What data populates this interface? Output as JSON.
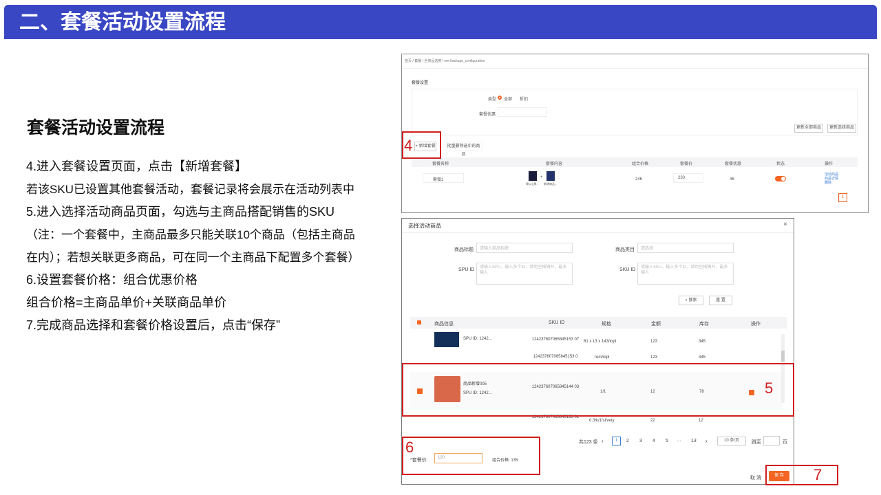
{
  "slide": {
    "header_title": "二、套餐活动设置流程",
    "subtitle": "套餐活动设置流程",
    "lines": [
      "4.进入套餐设置页面，点击【新增套餐】",
      "若该SKU已设置其他套餐活动，套餐记录将会展示在活动列表中",
      "5.进入选择活动商品页面，勾选与主商品搭配销售的SKU",
      "（注：一个套餐中，主商品最多只能关联10个商品（包括主商品",
      "在内）；若想关联更多商品，可在同一个主商品下配置多个套餐）",
      "6.设置套餐价格：组合优惠价格",
      "组合价格=主商品单价+关联商品单价",
      "7.完成商品选择和套餐价格设置后，点击“保存”"
    ]
  },
  "top_screen": {
    "breadcrumb": "首页 / 套餐 / 全商品选用 / em-hackage_configuration",
    "section_title": "套餐设置",
    "type_label": "类型",
    "type_opt1": "全部",
    "type_opt2": "折扣",
    "discount_label": "套餐优惠",
    "btn_a": "更新全部商品",
    "btn_b": "更新选择商品",
    "add_btn": "+ 新增套餐",
    "batch_btn": "批量删除选中的商品",
    "cols": [
      "套餐名称",
      "套餐内容",
      "组合价格",
      "套餐价",
      "套餐优惠",
      "状态",
      "操作"
    ],
    "row": {
      "name": "套餐1",
      "p1": "果to山果...",
      "plus": "+",
      "p2": "新增商品...",
      "combo": "246",
      "price": "230",
      "disc": "46",
      "ops": [
        "活动商品",
        "商品详情",
        "删除"
      ]
    },
    "page_num": "1",
    "marker": "4"
  },
  "modal": {
    "title": "选择活动商品",
    "close": "×",
    "f_title_label": "商品标题",
    "f_title_ph": "请输入商品标题",
    "f_cat_label": "商品类目",
    "f_cat_ph": "请选择",
    "f_spu_label": "SPU ID",
    "f_spu_ph": "请输入SPU，输入多个ID，请用空格隔开，最多输入",
    "f_sku_label": "SKU ID",
    "f_sku_ph": "请输入SKU，输入多个ID，请用空格隔开，最多输入",
    "search_btn": "搜索",
    "reset_btn": "重 置",
    "cols": [
      "商品信息",
      "SKU ID",
      "规格",
      "金额",
      "库存",
      "操作"
    ],
    "rows": [
      {
        "info": "SPU ID: 1242...",
        "sku": "124237607065845153 07",
        "spec": "61 x 13 x 143/iopl",
        "amt": "123",
        "stock": "345"
      },
      {
        "info": "",
        "sku": "124237607065845153 0",
        "spec": "rem/iopl",
        "amt": "123",
        "stock": "345"
      },
      {
        "info_title": "商品新增005",
        "info": "SPU ID: 1242...",
        "sku": "124237607065845144 03",
        "spec": "1/1",
        "amt": "12",
        "stock": "78"
      },
      {
        "info": "",
        "sku": "124237607065845153 01",
        "spec": "0.3/k/1/silvery",
        "amt": "22",
        "stock": "12"
      }
    ],
    "total": "共123 条",
    "pages": [
      "1",
      "2",
      "3",
      "4",
      "5",
      "···",
      "13"
    ],
    "page_size": "10 条/页",
    "jump": "跳至",
    "page_unit": "页",
    "price_label": "*套餐价:",
    "price_value": "120",
    "combo_label": "组合价格: 135",
    "cancel": "取 消",
    "save": "保 存",
    "marker5": "5",
    "marker6": "6",
    "marker7": "7"
  },
  "colors": {
    "header_bg": "#3a47c4",
    "accent": "#f26522",
    "highlight": "#d01e1e"
  }
}
